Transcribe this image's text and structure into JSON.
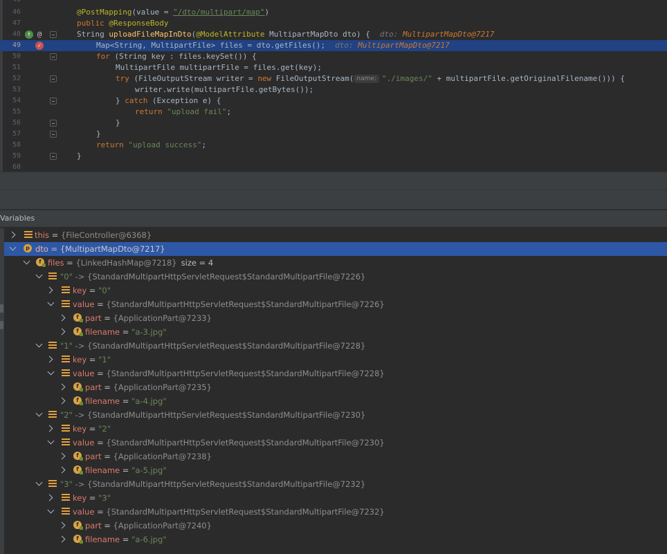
{
  "editor": {
    "lines": [
      {
        "num": "45"
      },
      {
        "num": "46",
        "annotation": "@PostMapping",
        "open": "(value = ",
        "url": "\"/dto/multipart/map\"",
        "close": ")"
      },
      {
        "num": "47",
        "kw": "public",
        "annotation": "@ResponseBody"
      },
      {
        "num": "48",
        "type": "String",
        "method": "uploadFileMapInDto",
        "ann": "@ModelAttribute",
        "rest": " MultipartMapDto dto) {",
        "hint_label": "dto:",
        "hint_value": "MultipartMapDto@7217"
      },
      {
        "num": "49",
        "code": "Map<String, MultipartFile> files = dto.getFiles();",
        "hint_label": "dto:",
        "hint_value": "MultipartMapDto@7217"
      },
      {
        "num": "50",
        "kw": "for",
        "rest": " (String key : files.keySet()) {"
      },
      {
        "num": "51",
        "code": "MultipartFile multipartFile = files.get(key);"
      },
      {
        "num": "52",
        "kw": "try",
        "mid": " (FileOutputStream writer = ",
        "kw2": "new",
        "mid2": " FileOutputStream(",
        "param": "name:",
        "str": "\"./images/\"",
        "rest": " + multipartFile.getOriginalFilename())) {"
      },
      {
        "num": "53",
        "code": "writer.write(multipartFile.getBytes());"
      },
      {
        "num": "54",
        "pre": "} ",
        "kw": "catch",
        "rest": " (Exception e) {"
      },
      {
        "num": "55",
        "kw": "return",
        "str": "\"upload fail\"",
        "rest": ";"
      },
      {
        "num": "56",
        "code": "}"
      },
      {
        "num": "57",
        "code": "}"
      },
      {
        "num": "58",
        "kw": "return",
        "str": "\"upload success\"",
        "rest": ";"
      },
      {
        "num": "59",
        "code": "}"
      },
      {
        "num": "60"
      }
    ]
  },
  "panel": {
    "title": "Variables"
  },
  "variables": [
    {
      "name": "this",
      "value": "{FileController@6368}"
    },
    {
      "name": "dto",
      "value": "{MultipartMapDto@7217}",
      "icon_letter": "p"
    },
    {
      "name": "files",
      "value": "{LinkedHashMap@7218}",
      "size": "size = 4",
      "icon_letter": "f"
    },
    {
      "key": "\"0\"",
      "value": "{StandardMultipartHttpServletRequest$StandardMultipartFile@7226}"
    },
    {
      "name": "key",
      "value": "\"0\""
    },
    {
      "name": "value",
      "value": "{StandardMultipartHttpServletRequest$StandardMultipartFile@7226}"
    },
    {
      "name": "part",
      "value": "{ApplicationPart@7233}",
      "icon_letter": "f"
    },
    {
      "name": "filename",
      "value": "\"a-3.jpg\"",
      "icon_letter": "f"
    },
    {
      "key": "\"1\"",
      "value": "{StandardMultipartHttpServletRequest$StandardMultipartFile@7228}"
    },
    {
      "name": "key",
      "value": "\"1\""
    },
    {
      "name": "value",
      "value": "{StandardMultipartHttpServletRequest$StandardMultipartFile@7228}"
    },
    {
      "name": "part",
      "value": "{ApplicationPart@7235}",
      "icon_letter": "f"
    },
    {
      "name": "filename",
      "value": "\"a-4.jpg\"",
      "icon_letter": "f"
    },
    {
      "key": "\"2\"",
      "value": "{StandardMultipartHttpServletRequest$StandardMultipartFile@7230}"
    },
    {
      "name": "key",
      "value": "\"2\""
    },
    {
      "name": "value",
      "value": "{StandardMultipartHttpServletRequest$StandardMultipartFile@7230}"
    },
    {
      "name": "part",
      "value": "{ApplicationPart@7238}",
      "icon_letter": "f"
    },
    {
      "name": "filename",
      "value": "\"a-5.jpg\"",
      "icon_letter": "f"
    },
    {
      "key": "\"3\"",
      "value": "{StandardMultipartHttpServletRequest$StandardMultipartFile@7232}"
    },
    {
      "name": "key",
      "value": "\"3\""
    },
    {
      "name": "value",
      "value": "{StandardMultipartHttpServletRequest$StandardMultipartFile@7232}"
    },
    {
      "name": "part",
      "value": "{ApplicationPart@7240}",
      "icon_letter": "f"
    },
    {
      "name": "filename",
      "value": "\"a-6.jpg\"",
      "icon_letter": "f"
    }
  ],
  "colors": {
    "editor_bg": "#2b2b2b",
    "execution_line": "#214283",
    "selected_row": "#2e57a6",
    "keyword": "#cc7832",
    "string": "#6a8759",
    "annotation": "#bbb529",
    "method": "#ffc66d"
  },
  "icons": {
    "line48": [
      "breakpoint-override-icon",
      "annotation-icon"
    ],
    "line49": "breakpoint-icon"
  }
}
